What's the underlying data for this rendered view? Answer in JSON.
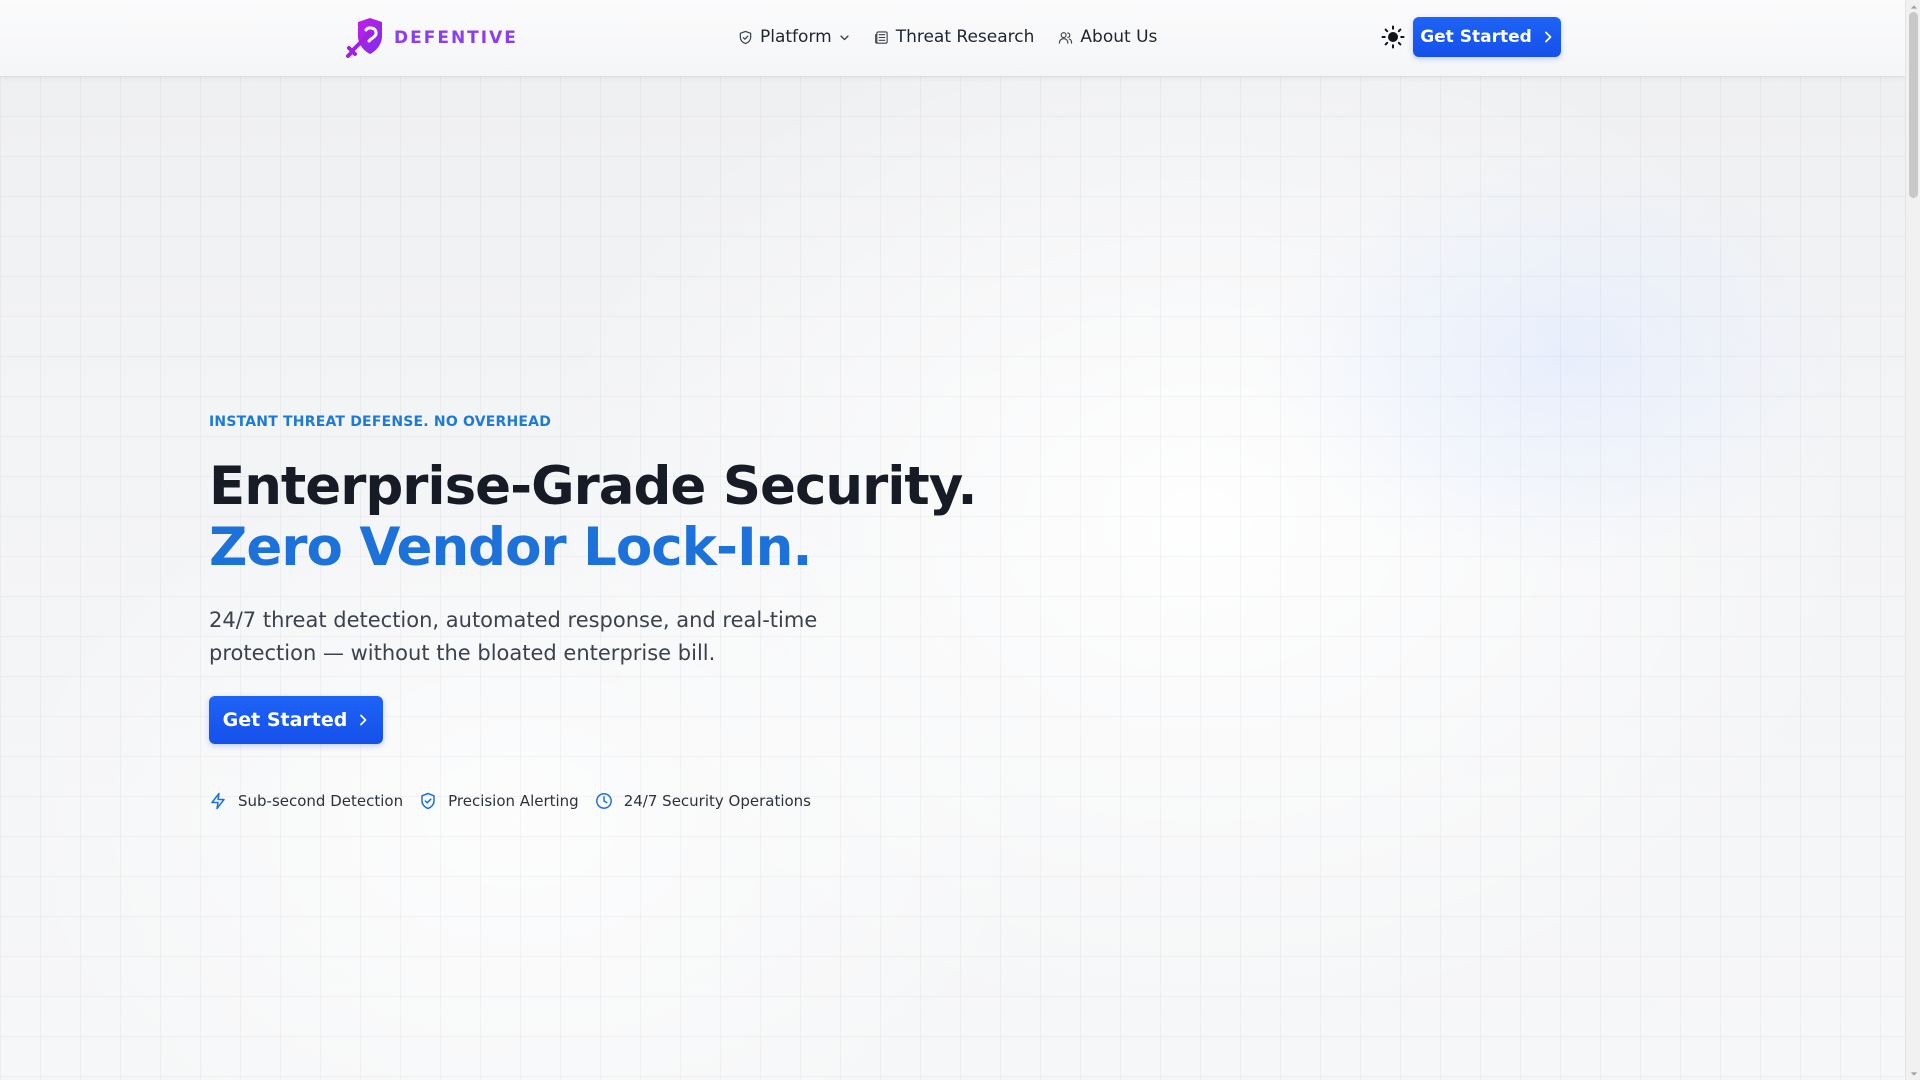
{
  "brand": {
    "name": "DEFENTIVE",
    "logo_icon": "shield-sword-logo",
    "accent": "#8b3df0"
  },
  "nav": {
    "items": [
      {
        "label": "Platform",
        "icon": "shield-icon",
        "has_dropdown": true
      },
      {
        "label": "Threat Research",
        "icon": "newspaper-icon"
      },
      {
        "label": "About Us",
        "icon": "users-icon"
      }
    ]
  },
  "header": {
    "theme_toggle_icon": "sun-icon",
    "cta_label": "Get Started"
  },
  "hero": {
    "eyebrow": "INSTANT THREAT DEFENSE. NO OVERHEAD",
    "headline_line1": "Enterprise-Grade Security.",
    "headline_line2": "Zero Vendor Lock-In.",
    "subtext": "24/7 threat detection, automated response, and real-time protection — without the bloated enterprise bill.",
    "cta_label": "Get Started",
    "features": [
      {
        "label": "Sub-second Detection",
        "icon": "lightning-icon"
      },
      {
        "label": "Precision Alerting",
        "icon": "shield-check-icon"
      },
      {
        "label": "24/7 Security Operations",
        "icon": "clock-icon"
      }
    ]
  },
  "colors": {
    "primary": "#1550ea",
    "headline_dark": "#161b26",
    "headline_blue": "#1c72d8",
    "eyebrow": "#1e7bd3"
  }
}
